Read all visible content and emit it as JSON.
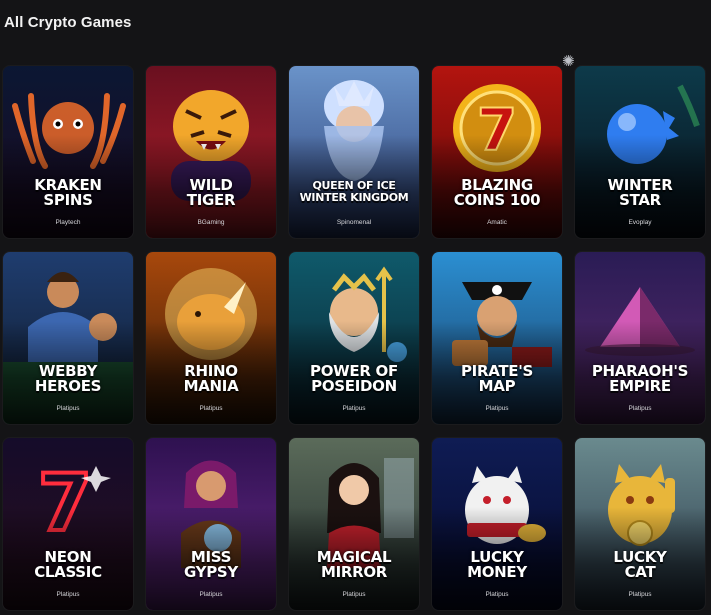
{
  "header": {
    "title": "All Crypto Games",
    "sparkle_icon": "sparkle-icon"
  },
  "games": [
    {
      "title_line1": "KRAKEN",
      "title_line2": "SPINS",
      "provider": "Playtech",
      "bg1": "#0b1733",
      "bg2": "#1c0a22",
      "accent": "#e0662a",
      "icon": "kraken-icon"
    },
    {
      "title_line1": "WILD",
      "title_line2": "TIGER",
      "provider": "BGaming",
      "bg1": "#6a1020",
      "bg2": "#b41f2a",
      "accent": "#f2a72b",
      "icon": "tiger-icon"
    },
    {
      "title_line1": "QUEEN OF ICE",
      "title_line2": "WINTER KINGDOM",
      "provider": "Spinomenal",
      "bg1": "#6a93c9",
      "bg2": "#2b3f77",
      "accent": "#dfe9ff",
      "icon": "ice-queen-icon"
    },
    {
      "title_line1": "BLAZING",
      "title_line2": "COINS 100",
      "provider": "Amatic",
      "bg1": "#b3140f",
      "bg2": "#5a0808",
      "accent": "#f3b41a",
      "icon": "lucky-seven-coin-icon"
    },
    {
      "title_line1": "WINTER",
      "title_line2": "STAR",
      "provider": "Evoplay",
      "bg1": "#0d3a4a",
      "bg2": "#08111b",
      "accent": "#2f7df0",
      "icon": "blue-orb-icon"
    },
    {
      "title_line1": "WEBBY",
      "title_line2": "HEROES",
      "provider": "Platipus",
      "bg1": "#1f3d6f",
      "bg2": "#0f1a2c",
      "accent": "#3c67b0",
      "icon": "hero-icon"
    },
    {
      "title_line1": "RHINO",
      "title_line2": "MANIA",
      "provider": "Platipus",
      "bg1": "#a8480c",
      "bg2": "#3a1b06",
      "accent": "#e9a03a",
      "icon": "rhino-icon"
    },
    {
      "title_line1": "POWER OF",
      "title_line2": "POSEIDON",
      "provider": "Platipus",
      "bg1": "#0f5a6b",
      "bg2": "#0a2430",
      "accent": "#e5c24a",
      "icon": "poseidon-icon"
    },
    {
      "title_line1": "PIRATE'S",
      "title_line2": "MAP",
      "provider": "Platipus",
      "bg1": "#2b8fd2",
      "bg2": "#1a3f66",
      "accent": "#c07a3a",
      "icon": "pirate-icon"
    },
    {
      "title_line1": "PHARAOH'S",
      "title_line2": "EMPIRE",
      "provider": "Platipus",
      "bg1": "#2a1c55",
      "bg2": "#5a2a6c",
      "accent": "#d25ab6",
      "icon": "pyramid-icon"
    },
    {
      "title_line1": "NEON",
      "title_line2": "CLASSIC",
      "provider": "Platipus",
      "bg1": "#150c2a",
      "bg2": "#2a0e1e",
      "accent": "#ff2d3d",
      "icon": "neon-seven-icon"
    },
    {
      "title_line1": "MISS",
      "title_line2": "GYPSY",
      "provider": "Platipus",
      "bg1": "#2e1150",
      "bg2": "#6a2a8a",
      "accent": "#8fd0ff",
      "icon": "fortune-teller-icon"
    },
    {
      "title_line1": "MAGICAL",
      "title_line2": "MIRROR",
      "provider": "Platipus",
      "bg1": "#5b6b5a",
      "bg2": "#1f2a2a",
      "accent": "#c7212d",
      "icon": "princess-icon"
    },
    {
      "title_line1": "LUCKY",
      "title_line2": "MONEY",
      "provider": "Platipus",
      "bg1": "#0f1c54",
      "bg2": "#05092a",
      "accent": "#f1f1f1",
      "icon": "maneki-neko-icon"
    },
    {
      "title_line1": "LUCKY",
      "title_line2": "CAT",
      "provider": "Platipus",
      "bg1": "#6a8a8e",
      "bg2": "#2a3a4a",
      "accent": "#e8b63a",
      "icon": "golden-cat-icon"
    }
  ]
}
